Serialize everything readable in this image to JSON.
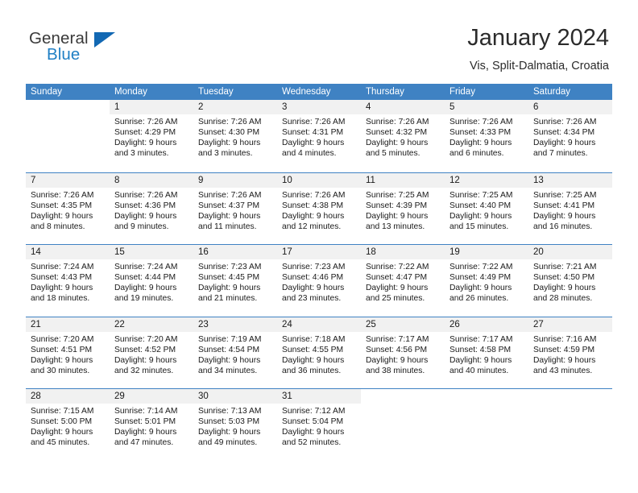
{
  "brand": {
    "name_part1": "General",
    "name_part2": "Blue",
    "triangle_color": "#1268b3",
    "blue_text_color": "#1f7fc4"
  },
  "header": {
    "title": "January 2024",
    "subtitle": "Vis, Split-Dalmatia, Croatia"
  },
  "theme": {
    "header_bg": "#3f82c3",
    "daynum_bg": "#f1f1f1",
    "rule_color": "#3f82c3"
  },
  "weekdays": [
    "Sunday",
    "Monday",
    "Tuesday",
    "Wednesday",
    "Thursday",
    "Friday",
    "Saturday"
  ],
  "weeks": [
    [
      {
        "day": "",
        "lines": []
      },
      {
        "day": "1",
        "lines": [
          "Sunrise: 7:26 AM",
          "Sunset: 4:29 PM",
          "Daylight: 9 hours",
          "and 3 minutes."
        ]
      },
      {
        "day": "2",
        "lines": [
          "Sunrise: 7:26 AM",
          "Sunset: 4:30 PM",
          "Daylight: 9 hours",
          "and 3 minutes."
        ]
      },
      {
        "day": "3",
        "lines": [
          "Sunrise: 7:26 AM",
          "Sunset: 4:31 PM",
          "Daylight: 9 hours",
          "and 4 minutes."
        ]
      },
      {
        "day": "4",
        "lines": [
          "Sunrise: 7:26 AM",
          "Sunset: 4:32 PM",
          "Daylight: 9 hours",
          "and 5 minutes."
        ]
      },
      {
        "day": "5",
        "lines": [
          "Sunrise: 7:26 AM",
          "Sunset: 4:33 PM",
          "Daylight: 9 hours",
          "and 6 minutes."
        ]
      },
      {
        "day": "6",
        "lines": [
          "Sunrise: 7:26 AM",
          "Sunset: 4:34 PM",
          "Daylight: 9 hours",
          "and 7 minutes."
        ]
      }
    ],
    [
      {
        "day": "7",
        "lines": [
          "Sunrise: 7:26 AM",
          "Sunset: 4:35 PM",
          "Daylight: 9 hours",
          "and 8 minutes."
        ]
      },
      {
        "day": "8",
        "lines": [
          "Sunrise: 7:26 AM",
          "Sunset: 4:36 PM",
          "Daylight: 9 hours",
          "and 9 minutes."
        ]
      },
      {
        "day": "9",
        "lines": [
          "Sunrise: 7:26 AM",
          "Sunset: 4:37 PM",
          "Daylight: 9 hours",
          "and 11 minutes."
        ]
      },
      {
        "day": "10",
        "lines": [
          "Sunrise: 7:26 AM",
          "Sunset: 4:38 PM",
          "Daylight: 9 hours",
          "and 12 minutes."
        ]
      },
      {
        "day": "11",
        "lines": [
          "Sunrise: 7:25 AM",
          "Sunset: 4:39 PM",
          "Daylight: 9 hours",
          "and 13 minutes."
        ]
      },
      {
        "day": "12",
        "lines": [
          "Sunrise: 7:25 AM",
          "Sunset: 4:40 PM",
          "Daylight: 9 hours",
          "and 15 minutes."
        ]
      },
      {
        "day": "13",
        "lines": [
          "Sunrise: 7:25 AM",
          "Sunset: 4:41 PM",
          "Daylight: 9 hours",
          "and 16 minutes."
        ]
      }
    ],
    [
      {
        "day": "14",
        "lines": [
          "Sunrise: 7:24 AM",
          "Sunset: 4:43 PM",
          "Daylight: 9 hours",
          "and 18 minutes."
        ]
      },
      {
        "day": "15",
        "lines": [
          "Sunrise: 7:24 AM",
          "Sunset: 4:44 PM",
          "Daylight: 9 hours",
          "and 19 minutes."
        ]
      },
      {
        "day": "16",
        "lines": [
          "Sunrise: 7:23 AM",
          "Sunset: 4:45 PM",
          "Daylight: 9 hours",
          "and 21 minutes."
        ]
      },
      {
        "day": "17",
        "lines": [
          "Sunrise: 7:23 AM",
          "Sunset: 4:46 PM",
          "Daylight: 9 hours",
          "and 23 minutes."
        ]
      },
      {
        "day": "18",
        "lines": [
          "Sunrise: 7:22 AM",
          "Sunset: 4:47 PM",
          "Daylight: 9 hours",
          "and 25 minutes."
        ]
      },
      {
        "day": "19",
        "lines": [
          "Sunrise: 7:22 AM",
          "Sunset: 4:49 PM",
          "Daylight: 9 hours",
          "and 26 minutes."
        ]
      },
      {
        "day": "20",
        "lines": [
          "Sunrise: 7:21 AM",
          "Sunset: 4:50 PM",
          "Daylight: 9 hours",
          "and 28 minutes."
        ]
      }
    ],
    [
      {
        "day": "21",
        "lines": [
          "Sunrise: 7:20 AM",
          "Sunset: 4:51 PM",
          "Daylight: 9 hours",
          "and 30 minutes."
        ]
      },
      {
        "day": "22",
        "lines": [
          "Sunrise: 7:20 AM",
          "Sunset: 4:52 PM",
          "Daylight: 9 hours",
          "and 32 minutes."
        ]
      },
      {
        "day": "23",
        "lines": [
          "Sunrise: 7:19 AM",
          "Sunset: 4:54 PM",
          "Daylight: 9 hours",
          "and 34 minutes."
        ]
      },
      {
        "day": "24",
        "lines": [
          "Sunrise: 7:18 AM",
          "Sunset: 4:55 PM",
          "Daylight: 9 hours",
          "and 36 minutes."
        ]
      },
      {
        "day": "25",
        "lines": [
          "Sunrise: 7:17 AM",
          "Sunset: 4:56 PM",
          "Daylight: 9 hours",
          "and 38 minutes."
        ]
      },
      {
        "day": "26",
        "lines": [
          "Sunrise: 7:17 AM",
          "Sunset: 4:58 PM",
          "Daylight: 9 hours",
          "and 40 minutes."
        ]
      },
      {
        "day": "27",
        "lines": [
          "Sunrise: 7:16 AM",
          "Sunset: 4:59 PM",
          "Daylight: 9 hours",
          "and 43 minutes."
        ]
      }
    ],
    [
      {
        "day": "28",
        "lines": [
          "Sunrise: 7:15 AM",
          "Sunset: 5:00 PM",
          "Daylight: 9 hours",
          "and 45 minutes."
        ]
      },
      {
        "day": "29",
        "lines": [
          "Sunrise: 7:14 AM",
          "Sunset: 5:01 PM",
          "Daylight: 9 hours",
          "and 47 minutes."
        ]
      },
      {
        "day": "30",
        "lines": [
          "Sunrise: 7:13 AM",
          "Sunset: 5:03 PM",
          "Daylight: 9 hours",
          "and 49 minutes."
        ]
      },
      {
        "day": "31",
        "lines": [
          "Sunrise: 7:12 AM",
          "Sunset: 5:04 PM",
          "Daylight: 9 hours",
          "and 52 minutes."
        ]
      },
      {
        "day": "",
        "lines": []
      },
      {
        "day": "",
        "lines": []
      },
      {
        "day": "",
        "lines": []
      }
    ]
  ]
}
